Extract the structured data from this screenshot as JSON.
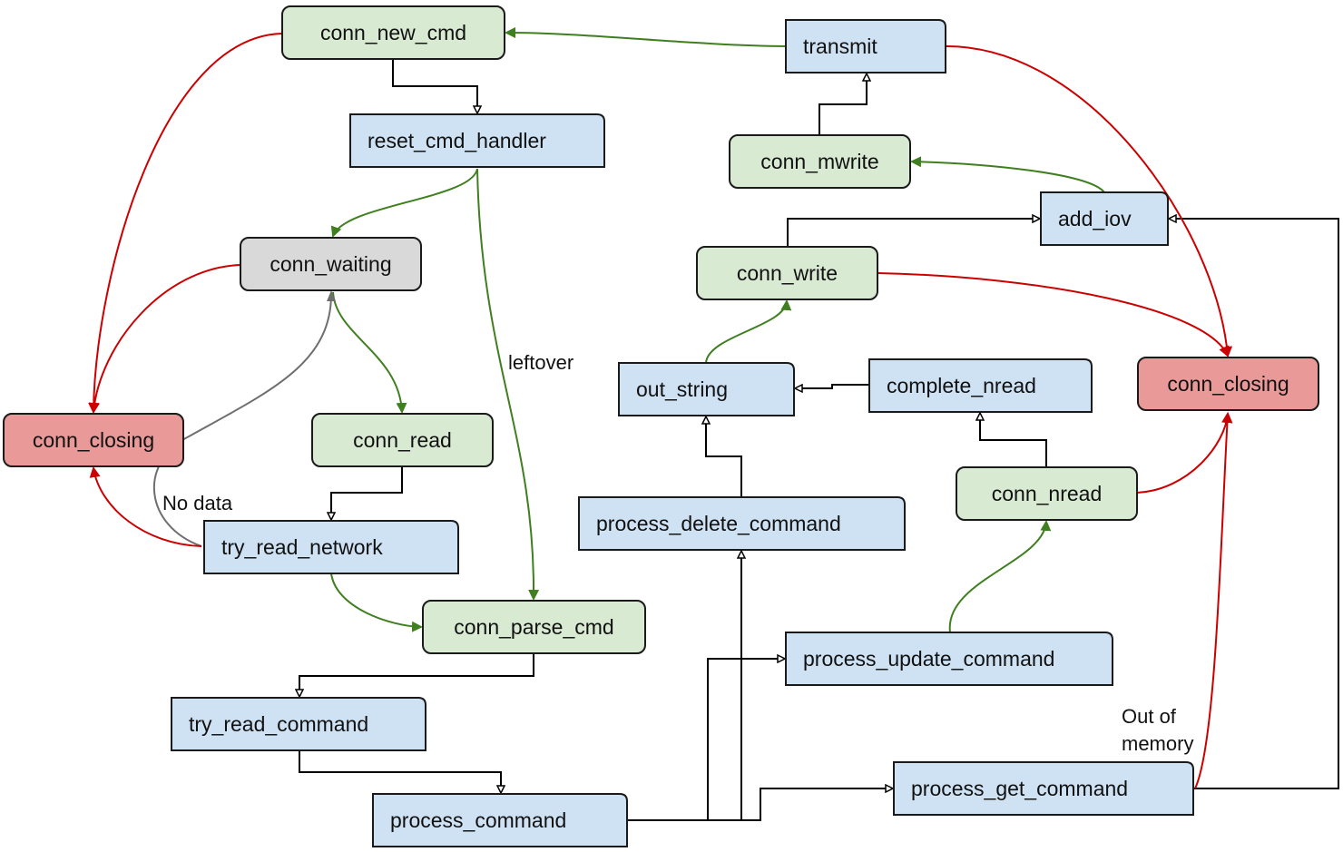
{
  "colors": {
    "green_fill": "#d9ead3",
    "blue_fill": "#cfe2f3",
    "grey_fill": "#d9d9d9",
    "red_fill": "#ea9999",
    "green_edge": "#3f7f1f",
    "red_edge": "#cc0000",
    "grey_edge": "#6e6e6e",
    "black_edge": "#000000"
  },
  "nodes": [
    {
      "id": "conn_new_cmd",
      "label": "conn_new_cmd",
      "kind": "green"
    },
    {
      "id": "reset_cmd_handler",
      "label": "reset_cmd_handler",
      "kind": "blue"
    },
    {
      "id": "transmit",
      "label": "transmit",
      "kind": "blue"
    },
    {
      "id": "conn_mwrite",
      "label": "conn_mwrite",
      "kind": "green"
    },
    {
      "id": "add_iov",
      "label": "add_iov",
      "kind": "blue"
    },
    {
      "id": "conn_waiting",
      "label": "conn_waiting",
      "kind": "grey"
    },
    {
      "id": "conn_write",
      "label": "conn_write",
      "kind": "green"
    },
    {
      "id": "out_string",
      "label": "out_string",
      "kind": "blue"
    },
    {
      "id": "complete_nread",
      "label": "complete_nread",
      "kind": "blue"
    },
    {
      "id": "conn_closing_right",
      "label": "conn_closing",
      "kind": "red"
    },
    {
      "id": "conn_closing_left",
      "label": "conn_closing",
      "kind": "red"
    },
    {
      "id": "conn_read",
      "label": "conn_read",
      "kind": "green"
    },
    {
      "id": "conn_nread",
      "label": "conn_nread",
      "kind": "green"
    },
    {
      "id": "process_delete_command",
      "label": "process_delete_command",
      "kind": "blue"
    },
    {
      "id": "try_read_network",
      "label": "try_read_network",
      "kind": "blue"
    },
    {
      "id": "conn_parse_cmd",
      "label": "conn_parse_cmd",
      "kind": "green"
    },
    {
      "id": "process_update_command",
      "label": "process_update_command",
      "kind": "blue"
    },
    {
      "id": "try_read_command",
      "label": "try_read_command",
      "kind": "blue"
    },
    {
      "id": "process_get_command",
      "label": "process_get_command",
      "kind": "blue"
    },
    {
      "id": "process_command",
      "label": "process_command",
      "kind": "blue"
    }
  ],
  "edge_labels": {
    "leftover": "leftover",
    "no_data": "No data",
    "out_of_memory_1": "Out of",
    "out_of_memory_2": "memory"
  }
}
